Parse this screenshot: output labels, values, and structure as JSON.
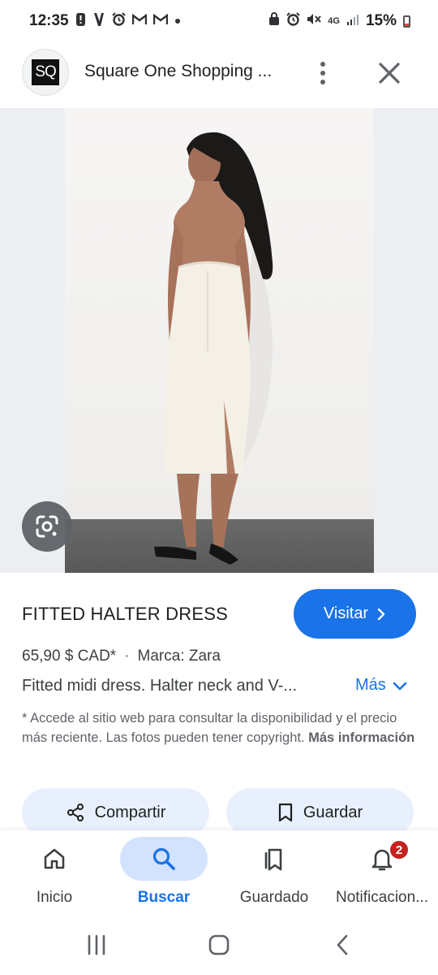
{
  "status_bar": {
    "time": "12:35",
    "left_icons": [
      "alert-icon",
      "v-icon",
      "alarm-icon",
      "gmail-icon",
      "gmail-icon",
      "dot-icon"
    ],
    "network": "4G",
    "battery": "15%"
  },
  "header": {
    "logo_text": "SQ",
    "title": "Square One Shopping ..."
  },
  "product": {
    "title": "FITTED HALTER DRESS",
    "visit_label": "Visitar",
    "price": "65,90 $ CAD*",
    "separator": "·",
    "brand": "Marca: Zara",
    "description": "Fitted midi dress. Halter neck and V-...",
    "more_label": "Más",
    "disclaimer_text": "* Accede al sitio web para consultar la disponibilidad y el precio más reciente. Las fotos pueden tener copyright.",
    "disclaimer_link": "Más información"
  },
  "actions": {
    "share_label": "Compartir",
    "save_label": "Guardar"
  },
  "bottom_nav": {
    "items": [
      {
        "label": "Inicio",
        "icon": "home-icon"
      },
      {
        "label": "Buscar",
        "icon": "search-icon",
        "active": true
      },
      {
        "label": "Guardado",
        "icon": "bookmarks-icon"
      },
      {
        "label": "Notificacion...",
        "icon": "bell-icon",
        "badge": "2"
      }
    ]
  },
  "colors": {
    "accent": "#1a73e8",
    "chip_bg": "#e8f0fe",
    "badge": "#c5221f"
  }
}
